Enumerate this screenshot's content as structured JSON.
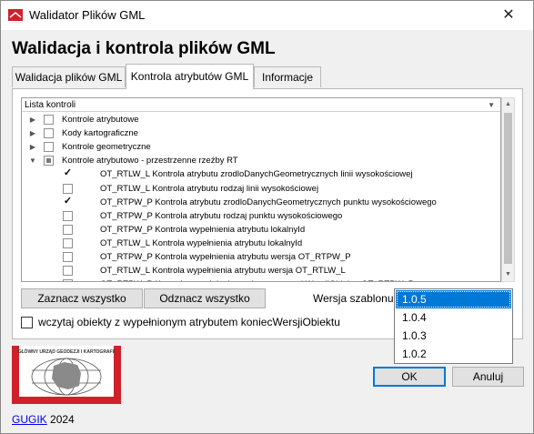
{
  "window": {
    "title": "Walidator Plików GML",
    "close_glyph": "✕"
  },
  "heading": "Walidacja i kontrola plików GML",
  "tabs": [
    {
      "label": "Walidacja plików GML",
      "active": false
    },
    {
      "label": "Kontrola atrybutów GML",
      "active": true
    },
    {
      "label": "Informacje",
      "active": false
    }
  ],
  "tree": {
    "header": "Lista kontroli",
    "rows": [
      {
        "label": "Kontrole atrybutowe",
        "level": 0,
        "expander": "▶",
        "state": "unchecked"
      },
      {
        "label": "Kody kartograficzne",
        "level": 0,
        "expander": "▶",
        "state": "unchecked"
      },
      {
        "label": "Kontrole geometryczne",
        "level": 0,
        "expander": "▶",
        "state": "unchecked"
      },
      {
        "label": "Kontrole atrybutowo - przestrzenne rzeźby RT",
        "level": 0,
        "expander": "▼",
        "state": "partial"
      },
      {
        "label": "OT_RTLW_L Kontrola atrybutu zrodloDanychGeometrycznych linii wysokościowej",
        "level": 1,
        "expander": "",
        "state": "checked"
      },
      {
        "label": "OT_RTLW_L Kontrola atrybutu rodzaj linii wysokościowej",
        "level": 1,
        "expander": "",
        "state": "unchecked"
      },
      {
        "label": "OT_RTPW_P Kontrola atrybutu zrodloDanychGeometrycznych punktu wysokościowego",
        "level": 1,
        "expander": "",
        "state": "checked"
      },
      {
        "label": "OT_RTPW_P Kontrola atrybutu rodzaj punktu wysokościowego",
        "level": 1,
        "expander": "",
        "state": "unchecked"
      },
      {
        "label": "OT_RTPW_P Kontrola wypełnienia atrybutu lokalnyId",
        "level": 1,
        "expander": "",
        "state": "unchecked"
      },
      {
        "label": "OT_RTLW_L Kontrola wypełnienia atrybutu lokalnyId",
        "level": 1,
        "expander": "",
        "state": "unchecked"
      },
      {
        "label": "OT_RTPW_P Kontrola wypełnienia atrybutu wersja OT_RTPW_P",
        "level": 1,
        "expander": "",
        "state": "unchecked"
      },
      {
        "label": "OT_RTLW_L Kontrola wypełnienia atrybutu wersja OT_RTLW_L",
        "level": 1,
        "expander": "",
        "state": "unchecked"
      },
      {
        "label": "OT_RTPW_P Kontrola wypełnienia atrybutu poczatekWersjiObiektu OT_RTPW_P",
        "level": 1,
        "expander": "",
        "state": "unchecked"
      }
    ]
  },
  "buttons": {
    "select_all": "Zaznacz wszystko",
    "deselect_all": "Odznacz wszystko",
    "ok": "OK",
    "cancel": "Anuluj"
  },
  "version": {
    "label": "Wersja szablonu:",
    "options": [
      "1.0.5",
      "1.0.4",
      "1.0.3",
      "1.0.2"
    ],
    "selected": "1.0.5"
  },
  "load_objects_checkbox": {
    "label": "wczytaj obiekty z wypełnionym atrybutem koniecWersjiObiektu",
    "checked": false
  },
  "logo_text": "GŁÓWNY URZĄD GEODEZJI I KARTOGRAFII",
  "footer": {
    "link": "GUGIK",
    "year": "2024"
  },
  "colors": {
    "accent": "#0078d7",
    "logo_red": "#d0212b"
  }
}
